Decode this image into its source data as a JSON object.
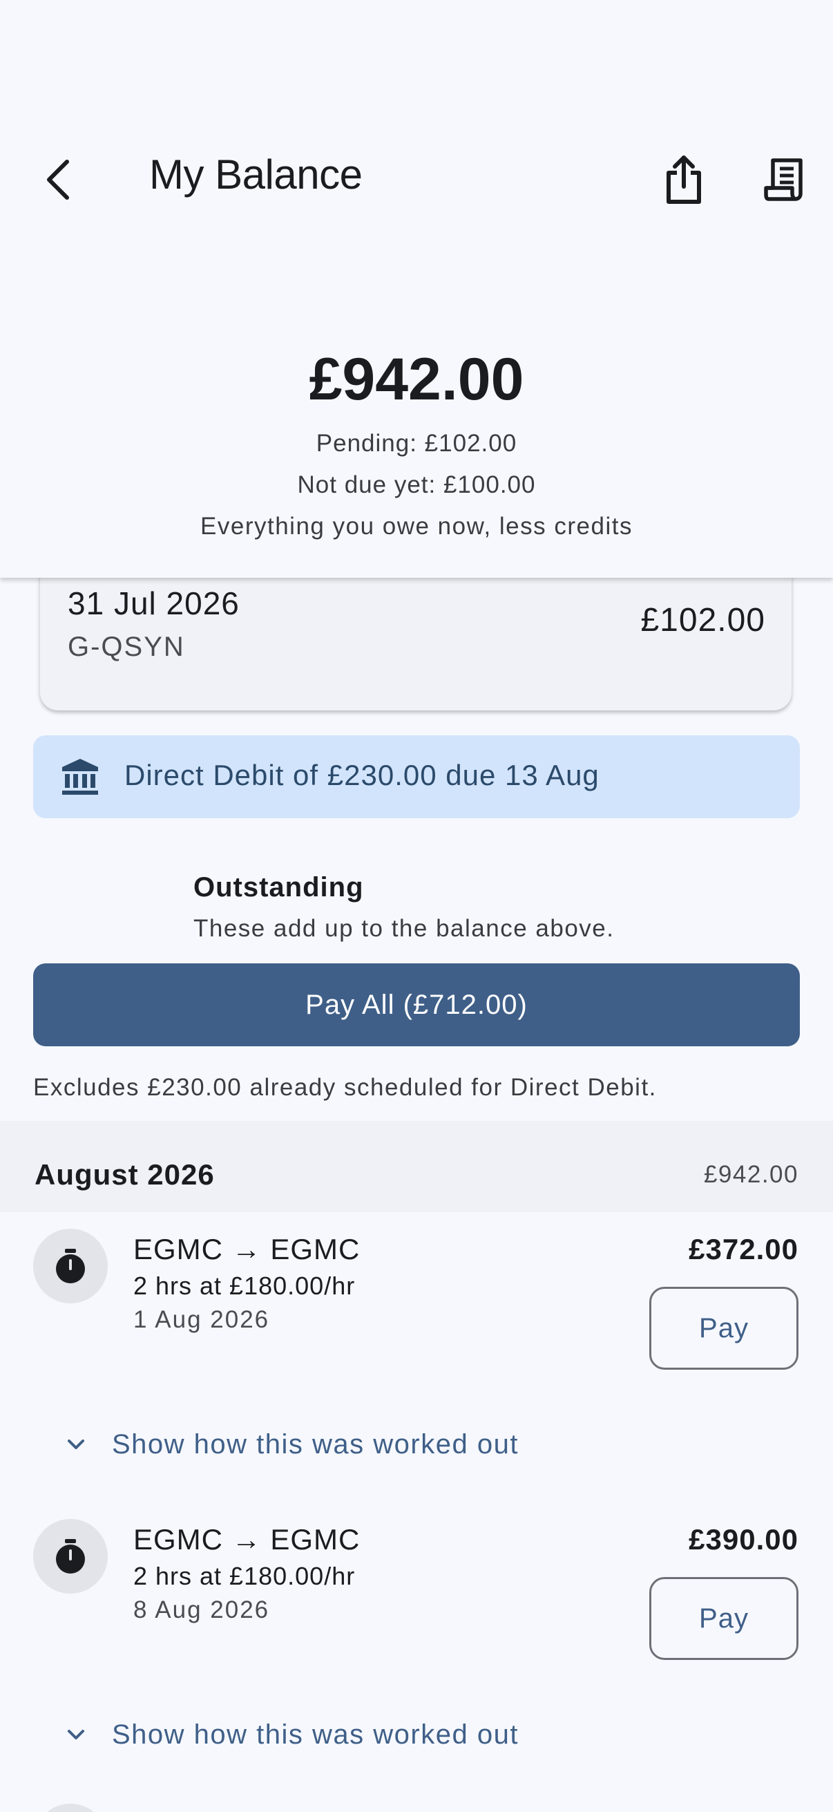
{
  "header": {
    "title": "My Balance",
    "back_icon": "back-arrow-icon",
    "share_icon": "share-icon",
    "receipt_icon": "receipt-icon"
  },
  "summary": {
    "balance": "£942.00",
    "pending": "Pending: £102.00",
    "not_due": "Not due yet: £100.00",
    "explanation": "Everything you owe now, less credits"
  },
  "pending_card": {
    "date": "31 Jul 2026",
    "registration": "G-QSYN",
    "amount": "£102.00"
  },
  "direct_debit": {
    "icon": "bank-icon",
    "text": "Direct Debit of £230.00 due 13 Aug"
  },
  "outstanding": {
    "title": "Outstanding",
    "subtitle": "These add up to the balance above.",
    "pay_all_label": "Pay All (£712.00)",
    "excludes_note": "Excludes £230.00 already scheduled for Direct Debit."
  },
  "month": {
    "label": "August 2026",
    "total": "£942.00"
  },
  "transactions": [
    {
      "icon": "stopwatch-icon",
      "route": "EGMC → EGMC",
      "rate": "2 hrs at £180.00/hr",
      "date": "1 Aug 2026",
      "amount": "£372.00",
      "pay_label": "Pay",
      "show_label": "Show how this was worked out"
    },
    {
      "icon": "stopwatch-icon",
      "route": "EGMC → EGMC",
      "rate": "2 hrs at £180.00/hr",
      "date": "8 Aug 2026",
      "amount": "£390.00",
      "pay_label": "Pay",
      "show_label": "Show how this was worked out"
    }
  ],
  "colors": {
    "background": "#f6f8fd",
    "accent": "#3f5f88",
    "banner": "#d2e4fb",
    "banner_text": "#2b4a6b"
  }
}
